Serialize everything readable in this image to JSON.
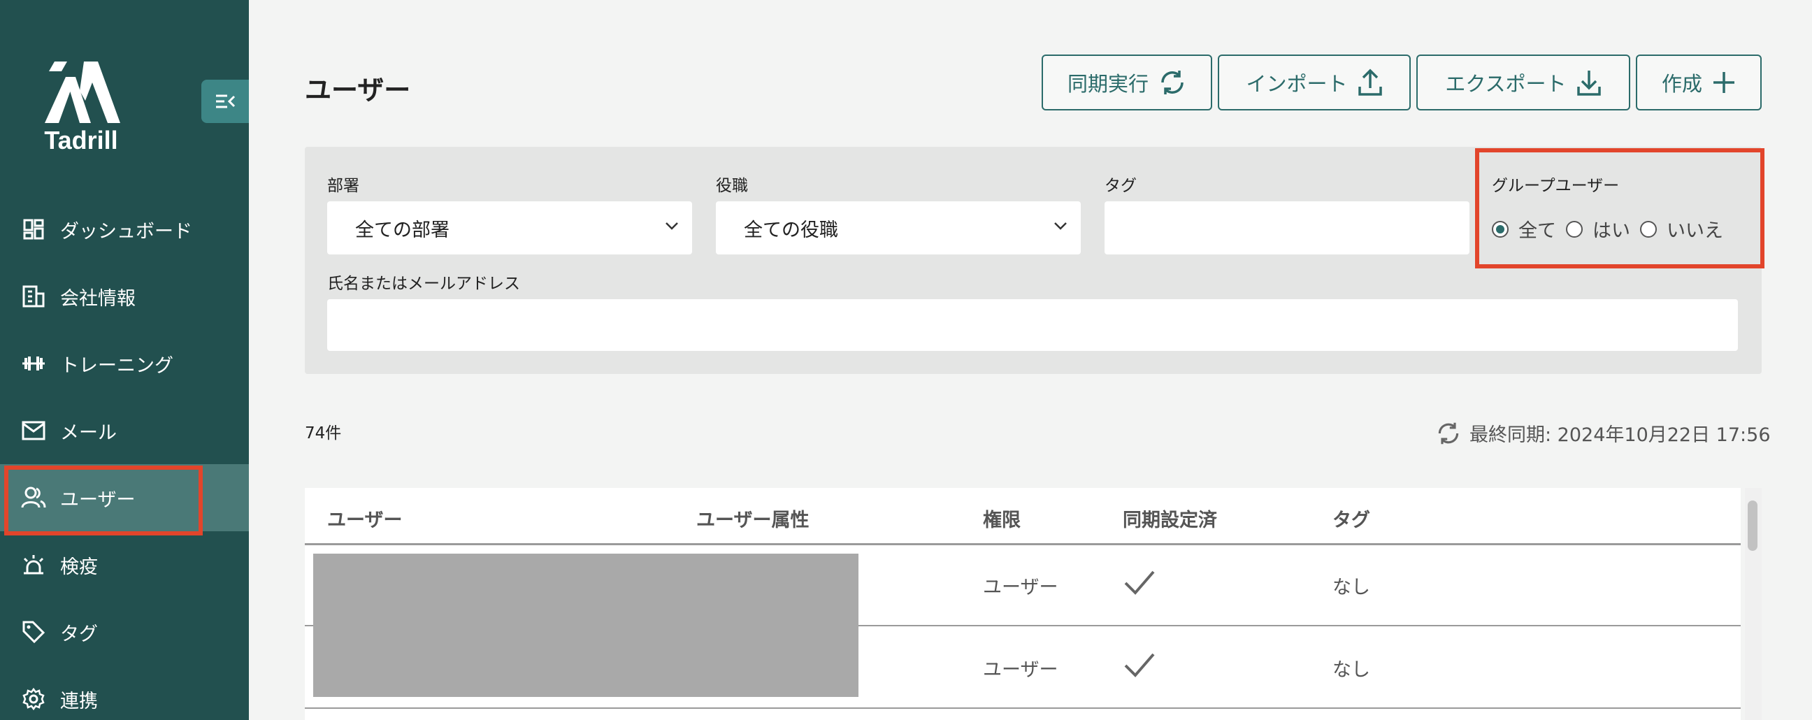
{
  "app": {
    "name": "Tadrill"
  },
  "sidebar": {
    "items": [
      {
        "label": "ダッシュボード",
        "icon": "dashboard-icon"
      },
      {
        "label": "会社情報",
        "icon": "building-icon"
      },
      {
        "label": "トレーニング",
        "icon": "dumbbell-icon"
      },
      {
        "label": "メール",
        "icon": "mail-icon"
      },
      {
        "label": "ユーザー",
        "icon": "users-icon",
        "active": true
      },
      {
        "label": "検疫",
        "icon": "siren-icon"
      },
      {
        "label": "タグ",
        "icon": "tag-icon"
      },
      {
        "label": "連携",
        "icon": "gear-icon"
      }
    ]
  },
  "header": {
    "title": "ユーザー",
    "buttons": {
      "sync": "同期実行",
      "import": "インポート",
      "export": "エクスポート",
      "create": "作成"
    }
  },
  "filters": {
    "department": {
      "label": "部署",
      "value": "全ての部署"
    },
    "position": {
      "label": "役職",
      "value": "全ての役職"
    },
    "tag": {
      "label": "タグ",
      "value": ""
    },
    "group_user": {
      "label": "グループユーザー",
      "options": [
        "全て",
        "はい",
        "いいえ"
      ],
      "selected": "全て"
    },
    "search": {
      "label": "氏名またはメールアドレス",
      "value": ""
    }
  },
  "summary": {
    "count": "74件",
    "last_sync": "最終同期: 2024年10月22日 17:56"
  },
  "table": {
    "columns": [
      "ユーザー",
      "ユーザー属性",
      "権限",
      "同期設定済",
      "タグ"
    ],
    "rows": [
      {
        "role": "ユーザー",
        "synced": true,
        "tag": "なし"
      },
      {
        "role": "ユーザー",
        "synced": true,
        "tag": "なし"
      }
    ]
  },
  "colors": {
    "sidebar": "#22504f",
    "accent": "#2b6b6a",
    "highlight": "#e2452b"
  }
}
